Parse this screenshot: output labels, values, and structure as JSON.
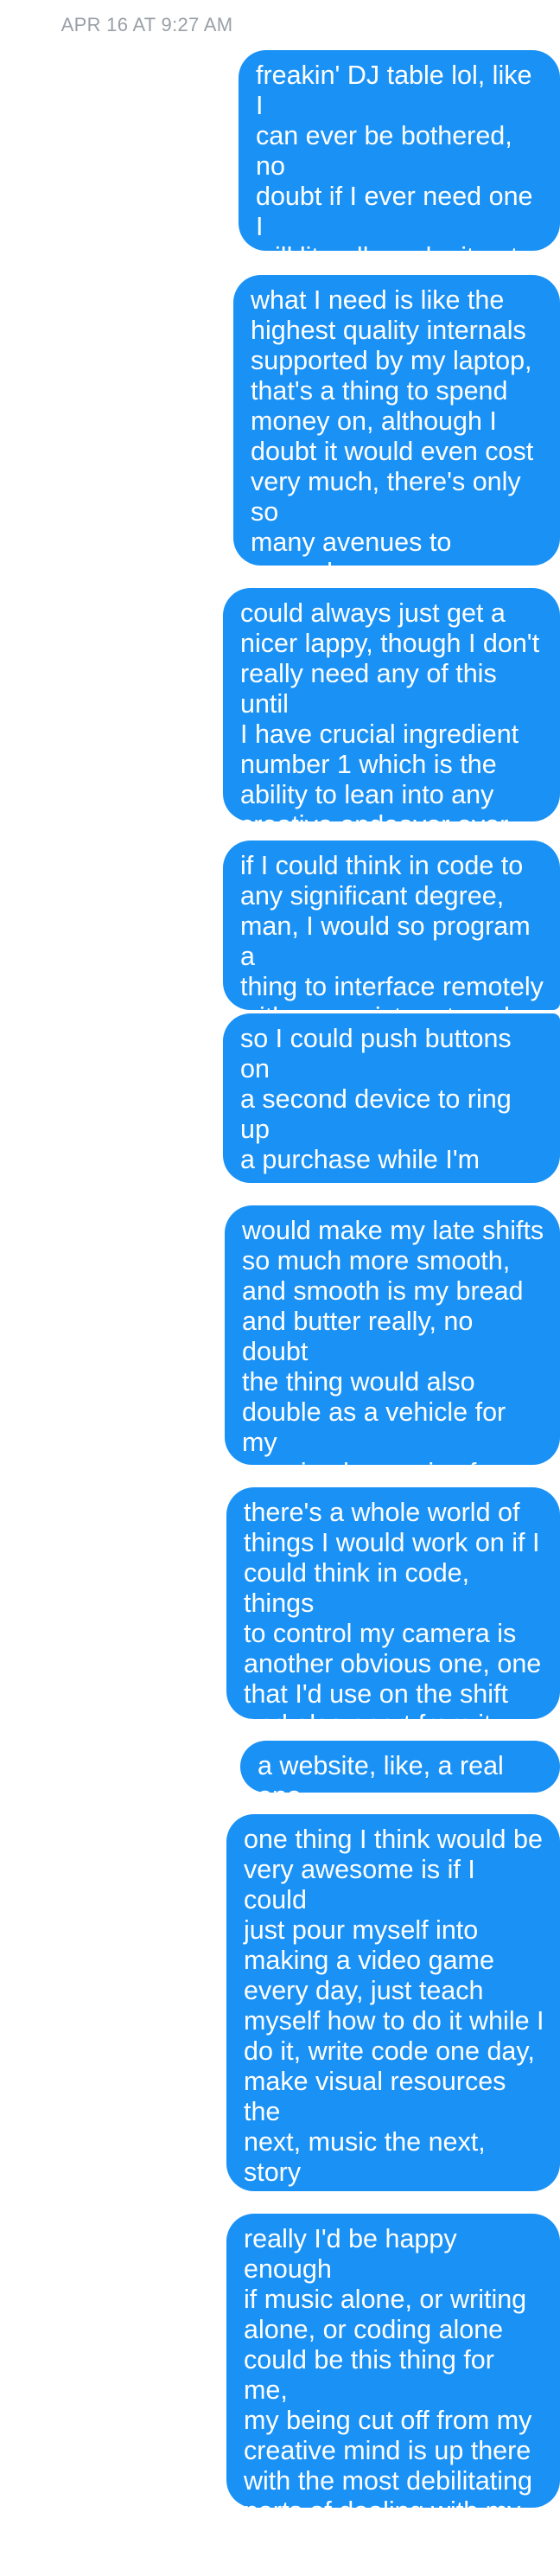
{
  "conversation": {
    "timestamp": "APR 16 AT 9:27 AM",
    "messages": [
      "freakin' DJ table lol, like I\ncan ever be bothered, no\ndoubt if I ever need one I\nwill literally make it out of\ncardboard and it'll just\nmake it cooler",
      "what I need is like the\nhighest quality internals\nsupported by my laptop,\nthat's a thing to spend\nmoney on, although I\ndoubt it would even cost\nvery much, there's only so\nmany avenues to upgrade\nif I recall",
      "could always just get a\nnicer lappy, though I don't\nreally need any of this until\nI have crucial ingredient\nnumber 1 which is the\nability to lean into any\ncreative endeavor ever",
      "if I could think in code to\nany significant degree,\nman, I would so program a\nthing to interface remotely\nwith my register at work",
      "so I could push buttons on\na second device to ring up\na purchase while I'm away\nfrom the register, and\nideally also talk to it",
      "would make my late shifts\nso much more smooth,\nand smooth is my bread\nand butter really, no doubt\nthe thing would also\ndouble as a vehicle for my\nongoing hypnosis of\ncustomers",
      "there's a whole world of\nthings I would work on if I\ncould think in code, things\nto control my camera is\nanother obvious one, one\nthat I'd use on the shift\nand also apart from it",
      "a website, like, a real one",
      "one thing I think would be\nvery awesome is if I could\njust pour myself into\nmaking a video game\nevery day, just teach\nmyself how to do it while I\ndo it, write code one day,\nmake visual resources the\nnext, music the next, story\nthe next, etc., it would be\nso nice if I could ever do\nthis",
      "really I'd be happy enough\nif music alone, or writing\nalone, or coding alone\ncould be this thing for me,\nmy being cut off from my\ncreative mind is up there\nwith the most debilitating\nparts of dealing with my\npresent life"
    ]
  }
}
